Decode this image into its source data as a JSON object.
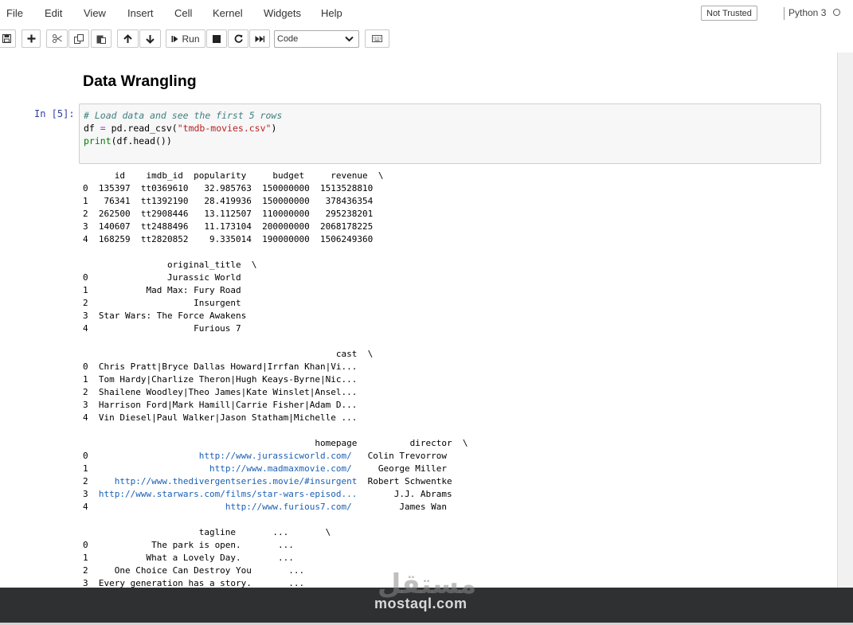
{
  "menu": [
    "File",
    "Edit",
    "View",
    "Insert",
    "Cell",
    "Kernel",
    "Widgets",
    "Help"
  ],
  "trust_label": "Not Trusted",
  "kernel_label": "Python 3",
  "toolbar": {
    "run_label": "Run",
    "cell_type": "Code"
  },
  "heading": "Data Wrangling",
  "cell": {
    "prompt": "In [5]:",
    "comment": "# Load data and see the first 5 rows",
    "line2_var": "df ",
    "line2_op": "=",
    "line2_call": " pd.read_csv(",
    "line2_str": "\"tmdb-movies.csv\"",
    "line2_end": ")",
    "line3_fn": "print",
    "line3_rest": "(df.head())"
  },
  "output": {
    "t1_header": "      id    imdb_id  popularity     budget     revenue  \\",
    "t1_rows": [
      "0  135397  tt0369610   32.985763  150000000  1513528810",
      "1   76341  tt1392190   28.419936  150000000   378436354",
      "2  262500  tt2908446   13.112507  110000000   295238201",
      "3  140607  tt2488496   11.173104  200000000  2068178225",
      "4  168259  tt2820852    9.335014  190000000  1506249360"
    ],
    "t2_header": "                original_title  \\",
    "t2_rows": [
      "0               Jurassic World",
      "1           Mad Max: Fury Road",
      "2                    Insurgent",
      "3  Star Wars: The Force Awakens",
      "4                    Furious 7"
    ],
    "t3_header": "                                                cast  \\",
    "t3_rows": [
      "0  Chris Pratt|Bryce Dallas Howard|Irrfan Khan|Vi...",
      "1  Tom Hardy|Charlize Theron|Hugh Keays-Byrne|Nic...",
      "2  Shailene Woodley|Theo James|Kate Winslet|Ansel...",
      "3  Harrison Ford|Mark Hamill|Carrie Fisher|Adam D...",
      "4  Vin Diesel|Paul Walker|Jason Statham|Michelle ..."
    ],
    "t4_header": "                                            homepage          director  \\",
    "t4_rows": [
      {
        "idx": "0  ",
        "url": "                   http://www.jurassicworld.com/",
        "dir": "   Colin Trevorrow"
      },
      {
        "idx": "1  ",
        "url": "                     http://www.madmaxmovie.com/",
        "dir": "     George Miller"
      },
      {
        "idx": "2  ",
        "url": "   http://www.thedivergentseries.movie/#insurgent",
        "dir": "  Robert Schwentke"
      },
      {
        "idx": "3  ",
        "url": "http://www.starwars.com/films/star-wars-episod...",
        "dir": "       J.J. Abrams"
      },
      {
        "idx": "4  ",
        "url": "                        http://www.furious7.com/",
        "dir": "         James Wan"
      }
    ],
    "t5_header": "                      tagline       ...       \\",
    "t5_rows": [
      "0            The park is open.       ...",
      "1           What a Lovely Day.       ...",
      "2     One Choice Can Destroy You       ...",
      "3  Every generation has a story.       ..."
    ]
  },
  "watermark": {
    "text": "mostaql.com",
    "logo": "مستقل"
  },
  "icons": {
    "save": "save-icon",
    "add": "plus-icon",
    "cut": "scissors-icon",
    "copy": "copy-icon",
    "paste": "paste-icon",
    "up": "arrow-up-icon",
    "down": "arrow-down-icon",
    "run": "step-forward-icon",
    "stop": "stop-icon",
    "restart": "restart-icon",
    "fast_forward": "fast-forward-icon",
    "keyboard": "keyboard-icon"
  },
  "colors": {
    "prompt": "#303f9f",
    "link": "#1a5fb4",
    "comment": "#408080",
    "string": "#ba2121",
    "builtin": "#008000"
  }
}
